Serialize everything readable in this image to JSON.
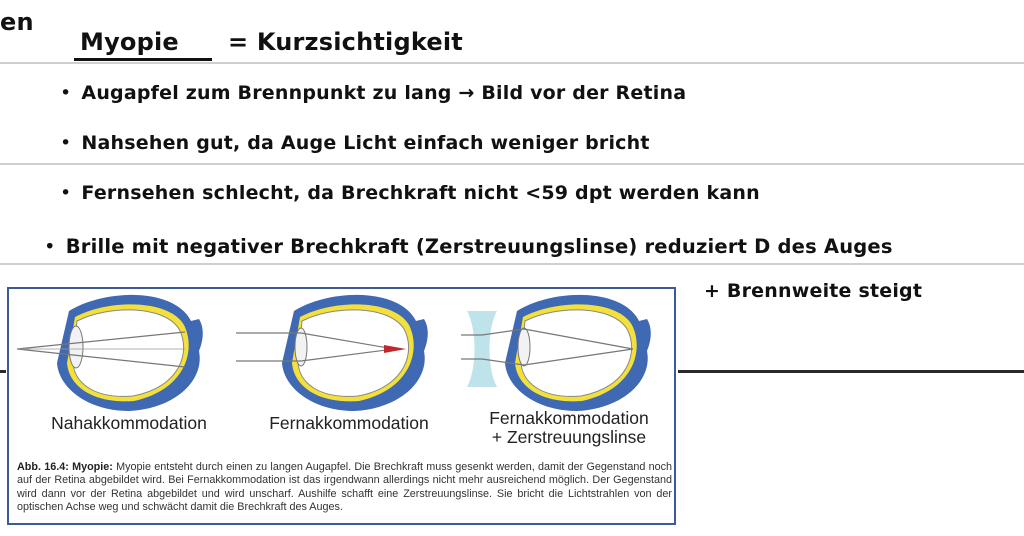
{
  "notes": {
    "corner_fragment": "en",
    "title": "Myopie",
    "title_equals": "= Kurzsichtigkeit",
    "lines": [
      "Augapfel zum Brennpunkt zu lang → Bild vor der Retina",
      "Nahsehen gut, da Auge Licht einfach weniger bricht",
      "Fernsehen schlecht, da Brechkraft nicht  <59 dpt werden kann",
      "Brille mit negativer Brechkraft (Zerstreuungslinse) reduziert D des Auges",
      "+ Brennweite steigt"
    ]
  },
  "figure": {
    "panels": [
      {
        "label": "Nahakkommodation"
      },
      {
        "label": "Fernakkommodation"
      },
      {
        "label": "Fernakkommodation\n+ Zerstreuungslinse"
      }
    ],
    "caption_heading": "Abb. 16.4: Myopie:",
    "caption_text": "Myopie entsteht durch einen zu langen Augapfel. Die Brechkraft muss gesenkt werden, damit der Gegenstand noch auf der Retina abgebildet wird. Bei Fernakkommodation ist das irgendwann allerdings nicht mehr ausreichend möglich. Der Gegenstand wird dann vor der Retina abgebildet und wird unscharf. Aushilfe schafft eine Zerstreuungslinse. Sie bricht die Lichtstrahlen von der optischen Achse weg und schwächt damit die Brechkraft des Auges."
  },
  "colors": {
    "eye_outer": "#3f69b3",
    "retina_yellow": "#f3e03a",
    "lens_blue": "#bfe3ea",
    "focus_red": "#c1272d",
    "figure_border": "#3b5b97"
  }
}
